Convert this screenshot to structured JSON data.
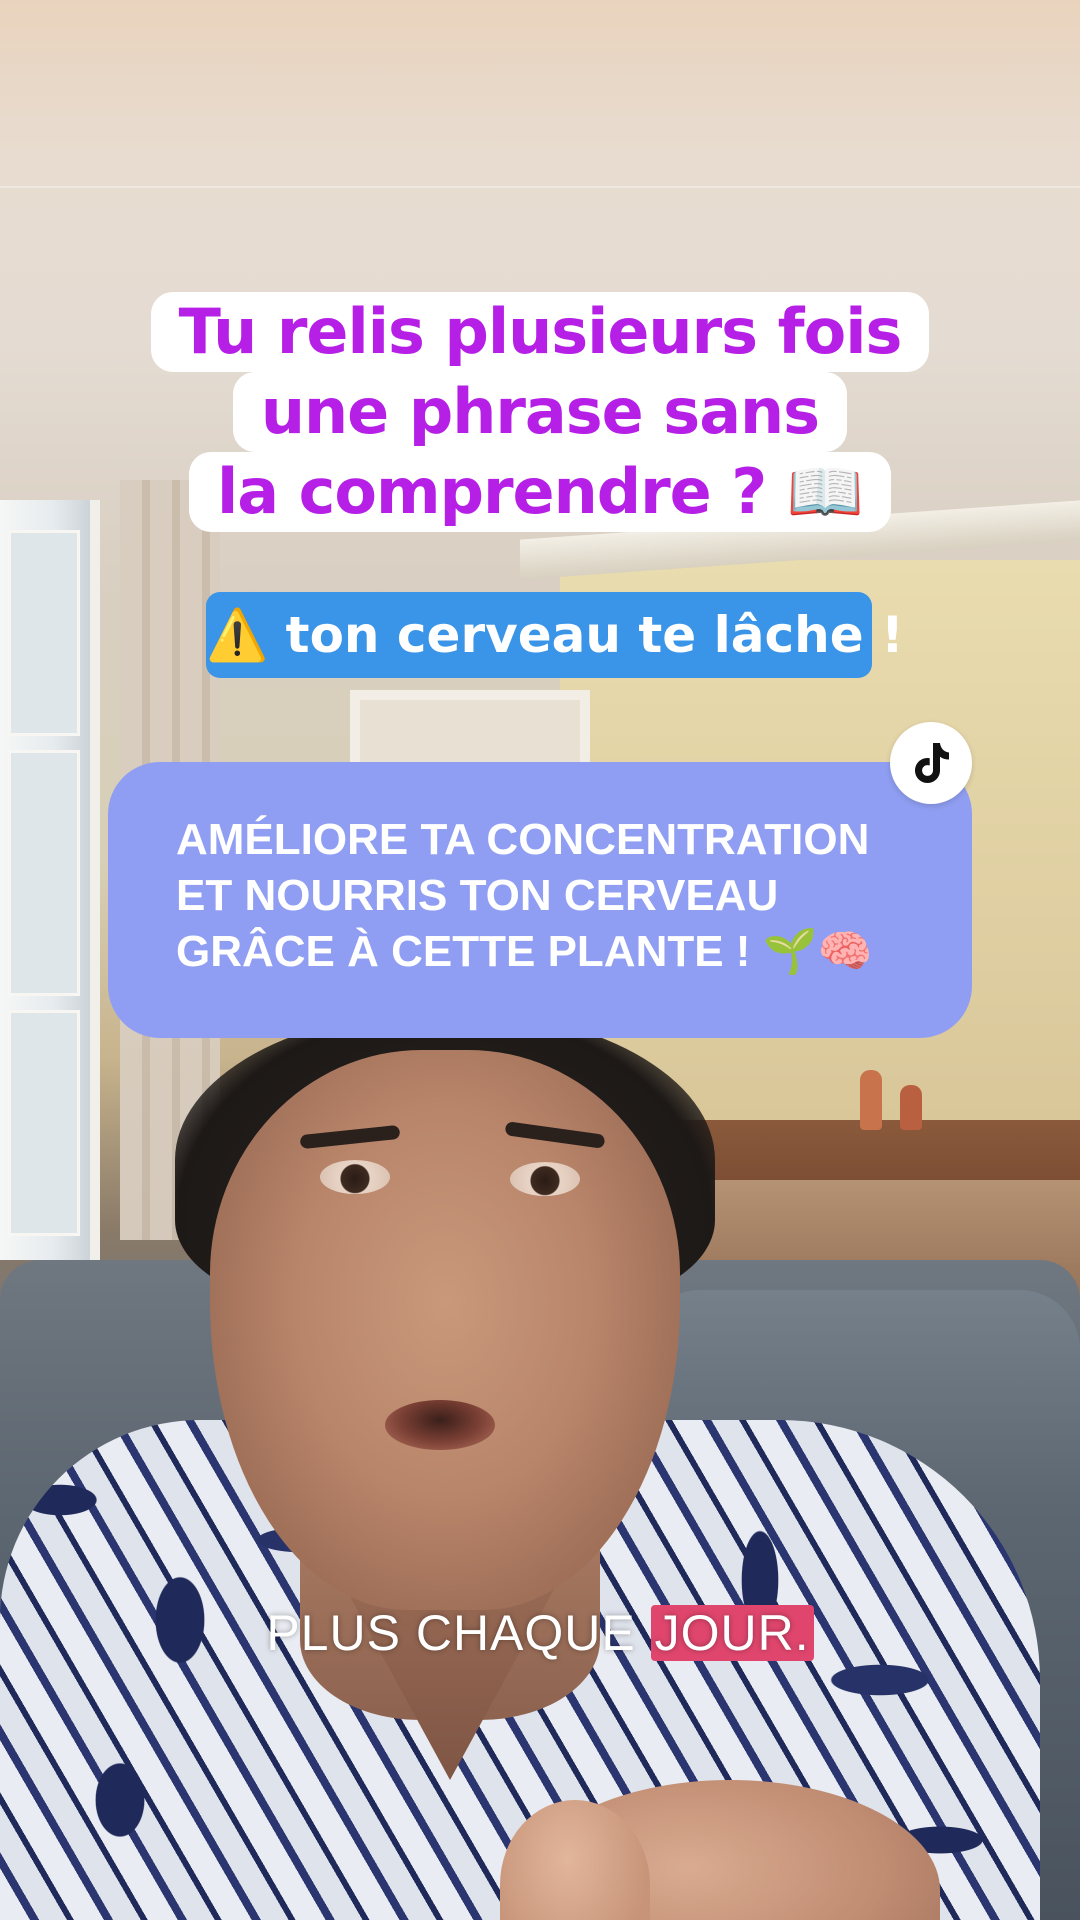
{
  "overlay": {
    "title_lines": [
      "Tu relis plusieurs fois",
      "une phrase sans",
      "la comprendre ? 📖"
    ],
    "title_color": "#b61fe6",
    "alert_text": "⚠️ ton cerveau te lâche !",
    "alert_color": "#3a94e8",
    "promo_lines": [
      "AMÉLIORE TA CONCENTRATION",
      "ET NOURRIS TON CERVEAU",
      "GRÂCE À CETTE PLANTE ! 🌱🧠"
    ],
    "promo_color": "#8f9ef2"
  },
  "logo": {
    "icon": "tiktok-icon"
  },
  "caption": {
    "before": "PLUS CHAQUE ",
    "highlight": "JOUR.",
    "highlight_color": "#e0466d"
  }
}
